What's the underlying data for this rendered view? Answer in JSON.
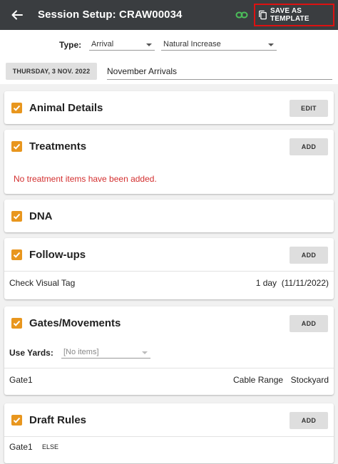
{
  "app": {
    "title": "Session Setup: CRAW00034",
    "save_template_label": "SAVE AS TEMPLATE"
  },
  "setup": {
    "type_label": "Type:",
    "type_value": "Arrival",
    "subtype_value": "Natural Increase",
    "date": "THURSDAY, 3 NOV. 2022",
    "session_name": "November Arrivals"
  },
  "cards": {
    "animal_details": {
      "title": "Animal Details",
      "button": "EDIT"
    },
    "treatments": {
      "title": "Treatments",
      "button": "ADD",
      "empty_message": "No treatment items have been added."
    },
    "dna": {
      "title": "DNA"
    },
    "followups": {
      "title": "Follow-ups",
      "button": "ADD",
      "items": [
        {
          "name": "Check Visual Tag",
          "when": "1 day  (11/11/2022)"
        }
      ]
    },
    "gates": {
      "title": "Gates/Movements",
      "button": "ADD",
      "use_yards_label": "Use Yards:",
      "use_yards_placeholder": "[No items]",
      "items": [
        {
          "gate": "Gate1",
          "range": "Cable Range",
          "yard": "Stockyard"
        }
      ]
    },
    "draft": {
      "title": "Draft Rules",
      "button": "ADD",
      "items": [
        {
          "gate": "Gate1",
          "rule": "ELSE"
        }
      ]
    }
  },
  "colors": {
    "appbar": "#3a3d40",
    "checkbox": "#e8961e",
    "link_icon": "#4cc05a",
    "highlight": "#dd1111",
    "error_text": "#d32f2f"
  },
  "icons": {
    "back": "arrow-left-icon",
    "link": "link-icon",
    "copy": "copy-icon",
    "check": "check-icon"
  }
}
